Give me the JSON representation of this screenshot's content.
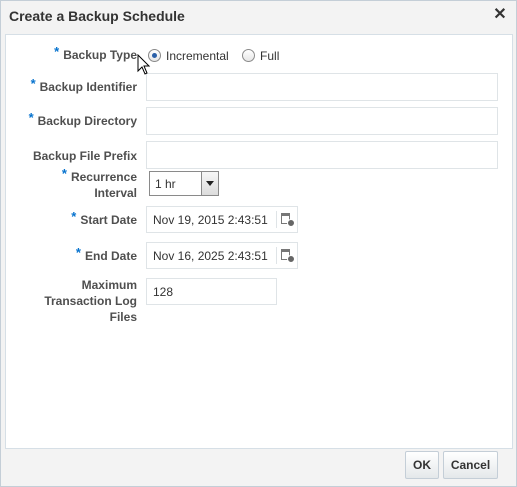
{
  "dialog": {
    "title": "Create a Backup Schedule",
    "close_icon": "close-icon"
  },
  "form": {
    "required_marker": "*",
    "backup_type": {
      "label": "Backup Type",
      "options": [
        {
          "label": "Incremental",
          "selected": true
        },
        {
          "label": "Full",
          "selected": false
        }
      ]
    },
    "backup_identifier": {
      "label": "Backup Identifier",
      "value": ""
    },
    "backup_directory": {
      "label": "Backup Directory",
      "value": ""
    },
    "backup_file_prefix": {
      "label": "Backup File Prefix",
      "value": ""
    },
    "recurrence_interval": {
      "label_line1": "Recurrence",
      "label_line2": "Interval",
      "value": "1 hr"
    },
    "start_date": {
      "label": "Start Date",
      "value": "Nov 19, 2015 2:43:51"
    },
    "end_date": {
      "label": "End Date",
      "value": "Nov 16, 2025 2:43:51"
    },
    "max_transaction_log_files": {
      "label_line1": "Maximum",
      "label_line2": "Transaction Log",
      "label_line3": "Files",
      "value": "128"
    }
  },
  "buttons": {
    "ok": "OK",
    "cancel": "Cancel"
  },
  "colors": {
    "required": "#0572ce",
    "radio_selected": "#2a5fa8"
  }
}
